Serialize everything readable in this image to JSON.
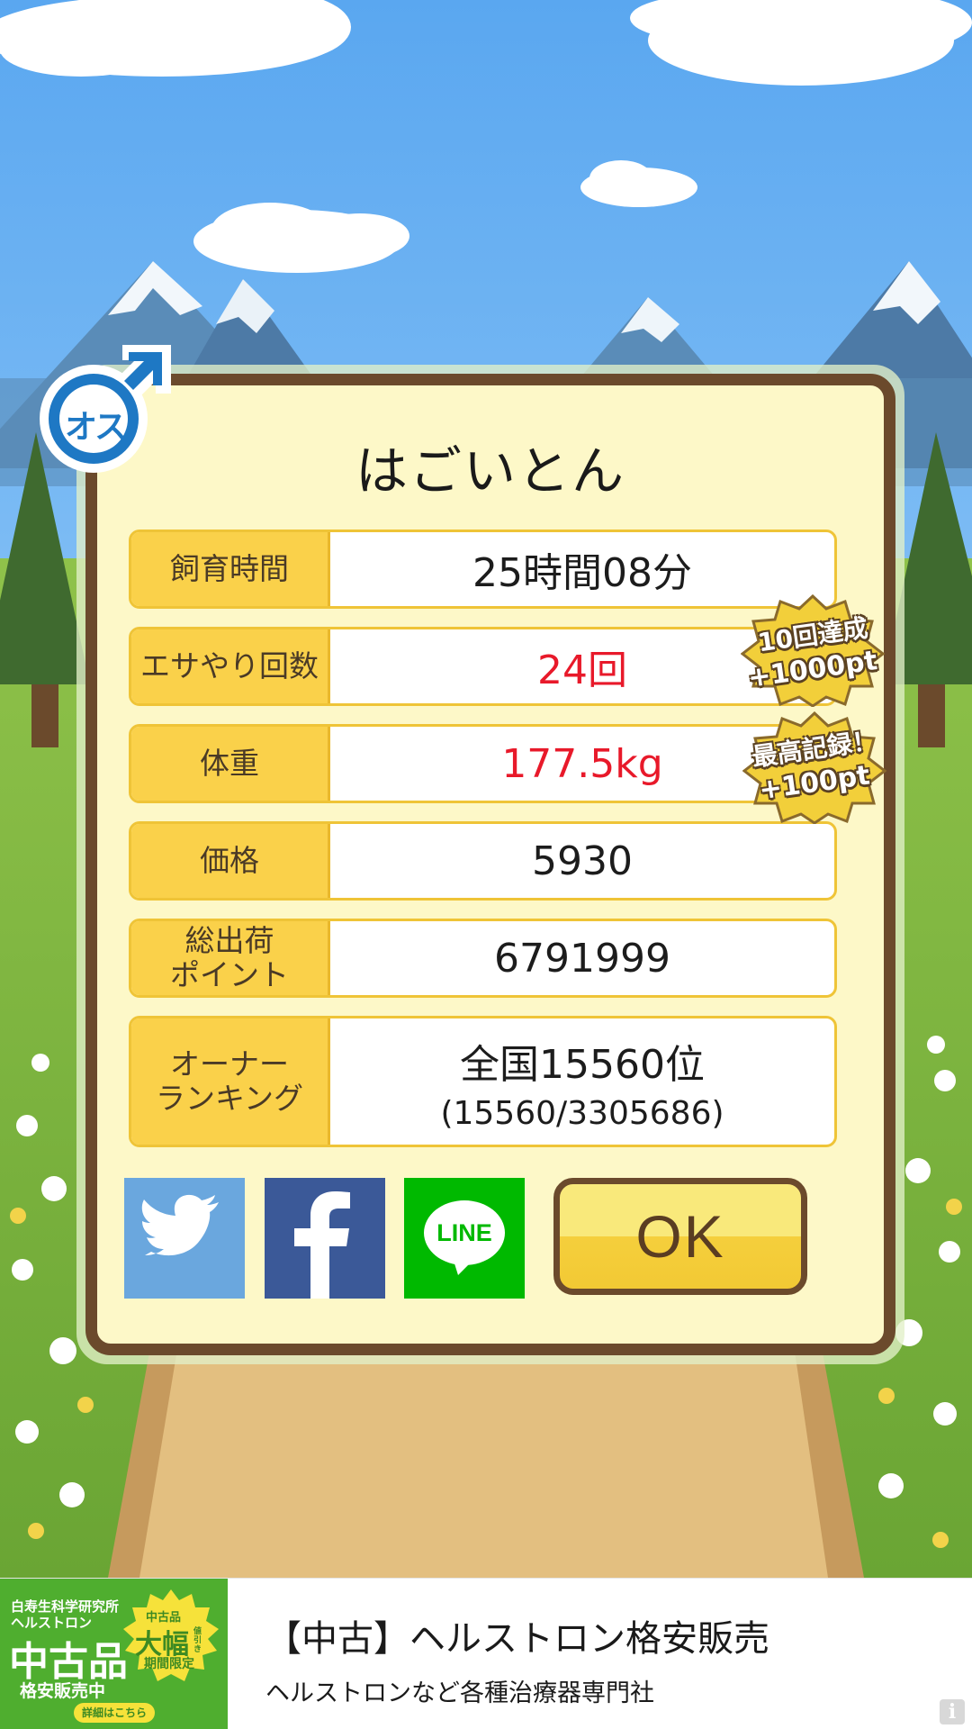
{
  "character": {
    "name": "はごいとん",
    "gender_symbol_text": "オス"
  },
  "stats": [
    {
      "label": "飼育時間",
      "value": "25時間08分",
      "sub": "",
      "highlight": false
    },
    {
      "label": "エサやり回数",
      "value": "24回",
      "sub": "",
      "highlight": true
    },
    {
      "label": "体重",
      "value": "177.5kg",
      "sub": "",
      "highlight": true
    },
    {
      "label": "価格",
      "value": "5930",
      "sub": "",
      "highlight": false
    },
    {
      "label": "総出荷\nポイント",
      "value": "6791999",
      "sub": "",
      "highlight": false
    },
    {
      "label": "オーナー\nランキング",
      "value": "全国15560位",
      "sub": "(15560/3305686)",
      "highlight": false
    }
  ],
  "badges": {
    "feed": {
      "line1": "10回達成",
      "line2": "+1000pt"
    },
    "weight": {
      "line1": "最高記録！",
      "line2": "+100pt"
    }
  },
  "share": {
    "twitter_icon": "twitter-bird-icon",
    "facebook_icon": "facebook-f-icon",
    "line_label": "LINE"
  },
  "ok_label": "OK",
  "ad": {
    "image_text": {
      "line1": "白寿生科学研究所",
      "line2": "ヘルストロン",
      "big": "中古品",
      "sub": "格安販売中",
      "burst_small": "中古品",
      "burst_big": "大幅",
      "burst_side": "値引き",
      "burst_bottom": "期間限定",
      "button": "詳細はこちら"
    },
    "title": "【中古】ヘルストロン格安販売",
    "description": "ヘルストロンなど各種治療器専門社",
    "info_icon": "i"
  },
  "colors": {
    "label_bg": "#fad14a",
    "highlight_text": "#e8192a",
    "frame": "#6b4a2c",
    "panel": "#fdf8c8",
    "gender_blue": "#1e78c4"
  }
}
